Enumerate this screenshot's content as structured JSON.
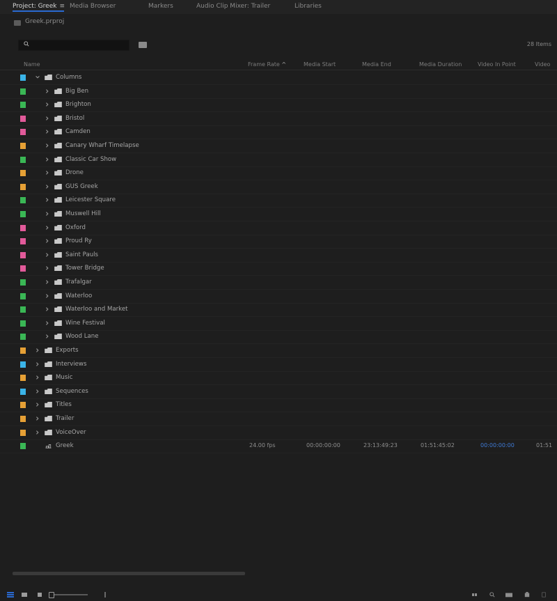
{
  "tabs": [
    {
      "label": "Project: Greek",
      "active": true,
      "menu": "≡"
    },
    {
      "label": "Media Browser",
      "active": false
    },
    {
      "label": "Markers",
      "active": false
    },
    {
      "label": "Audio Clip Mixer: Trailer",
      "active": false
    },
    {
      "label": "Libraries",
      "active": false
    }
  ],
  "project": {
    "path": "Greek.prproj",
    "search_placeholder": "",
    "item_count": "28 Items"
  },
  "columns": [
    {
      "label": "Name"
    },
    {
      "label": "Frame Rate",
      "sorted": true,
      "sort_indicator": "^"
    },
    {
      "label": "Media Start"
    },
    {
      "label": "Media End"
    },
    {
      "label": "Media Duration"
    },
    {
      "label": "Video In Point"
    },
    {
      "label": "Video"
    }
  ],
  "colors": {
    "accent": "#2a6ad2",
    "green": "#3ab755",
    "pink": "#e25a9a",
    "orange": "#e6a035",
    "blue": "#3ab4e8",
    "cyan": "#3ab4e8"
  },
  "rows": [
    {
      "name": "Columns",
      "depth": 0,
      "expanded": true,
      "type": "folder",
      "label_color": "cyan"
    },
    {
      "name": "Big Ben",
      "depth": 1,
      "type": "folder",
      "label_color": "green"
    },
    {
      "name": "Brighton",
      "depth": 1,
      "type": "folder",
      "label_color": "green"
    },
    {
      "name": "Bristol",
      "depth": 1,
      "type": "folder",
      "label_color": "pink"
    },
    {
      "name": "Camden",
      "depth": 1,
      "type": "folder",
      "label_color": "pink"
    },
    {
      "name": "Canary Wharf Timelapse",
      "depth": 1,
      "type": "folder",
      "label_color": "orange"
    },
    {
      "name": "Classic Car Show",
      "depth": 1,
      "type": "folder",
      "label_color": "green"
    },
    {
      "name": "Drone",
      "depth": 1,
      "type": "folder",
      "label_color": "orange"
    },
    {
      "name": "GUS Greek",
      "depth": 1,
      "type": "folder",
      "label_color": "orange"
    },
    {
      "name": "Leicester Square",
      "depth": 1,
      "type": "folder",
      "label_color": "green"
    },
    {
      "name": "Muswell Hill",
      "depth": 1,
      "type": "folder",
      "label_color": "green"
    },
    {
      "name": "Oxford",
      "depth": 1,
      "type": "folder",
      "label_color": "pink"
    },
    {
      "name": "Proud Ry",
      "depth": 1,
      "type": "folder",
      "label_color": "pink"
    },
    {
      "name": "Saint Pauls",
      "depth": 1,
      "type": "folder",
      "label_color": "pink"
    },
    {
      "name": "Tower Bridge",
      "depth": 1,
      "type": "folder",
      "label_color": "pink"
    },
    {
      "name": "Trafalgar",
      "depth": 1,
      "type": "folder",
      "label_color": "green"
    },
    {
      "name": "Waterloo",
      "depth": 1,
      "type": "folder",
      "label_color": "green"
    },
    {
      "name": "Waterloo and Market",
      "depth": 1,
      "type": "folder",
      "label_color": "green"
    },
    {
      "name": "Wine Festival",
      "depth": 1,
      "type": "folder",
      "label_color": "green"
    },
    {
      "name": "Wood Lane",
      "depth": 1,
      "type": "folder",
      "label_color": "green"
    },
    {
      "name": "Exports",
      "depth": 0,
      "type": "folder",
      "label_color": "orange"
    },
    {
      "name": "Interviews",
      "depth": 0,
      "type": "folder",
      "label_color": "cyan"
    },
    {
      "name": "Music",
      "depth": 0,
      "type": "folder",
      "label_color": "orange"
    },
    {
      "name": "Sequences",
      "depth": 0,
      "type": "folder",
      "label_color": "cyan"
    },
    {
      "name": "Titles",
      "depth": 0,
      "type": "folder",
      "label_color": "orange"
    },
    {
      "name": "Trailer",
      "depth": 0,
      "type": "folder",
      "label_color": "orange"
    },
    {
      "name": "VoiceOver",
      "depth": 0,
      "type": "folder",
      "label_color": "orange"
    },
    {
      "name": "Greek",
      "depth": 0,
      "type": "sequence",
      "label_color": "green",
      "frame_rate": "24.00 fps",
      "media_start": "00:00:00:00",
      "media_end": "23:13:49:23",
      "media_duration": "01:51:45:02",
      "video_in_point": "00:00:00:00",
      "video": "01:51"
    }
  ],
  "bottom": {
    "list_view_icon": "list-view-icon",
    "icon_view_icon": "icon-view-icon",
    "freeform_icon": "freeform-view-icon",
    "zoom_slider": 0.05
  }
}
